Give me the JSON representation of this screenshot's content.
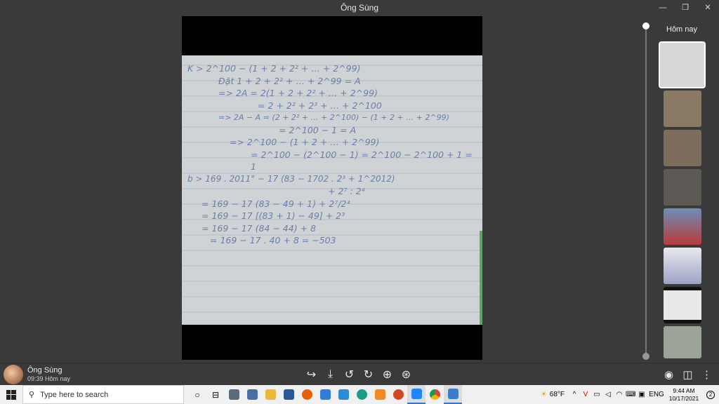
{
  "window": {
    "title": "Ông Sùng"
  },
  "sidebar": {
    "date_label": "Hôm nay"
  },
  "message": {
    "sender": "Ông Sùng",
    "time": "09:39 Hôm nay"
  },
  "notes": {
    "lines": [
      "K > 2^100 − (1 + 2 + 2² + … + 2^99)",
      "Đặt  1 + 2 + 2² + … + 2^99 = A",
      "=> 2A = 2(1 + 2 + 2² + … + 2^99)",
      "= 2 + 2² + 2³ + … + 2^100",
      "=> 2A − A = (2 + 2² + … + 2^100) − (1 + 2 + … + 2^99)",
      "= 2^100 − 1 = A",
      "=> 2^100 − (1 + 2 + … + 2^99)",
      "= 2^100 − (2^100 − 1) = 2^100 − 2^100 + 1 = 1",
      "b > 169 . 2011° − 17 (83 − 1702 . 2³ + 1^2012)",
      "+ 2⁷ : 2⁴",
      "= 169 − 17 (83 − 49 + 1) + 2⁷/2⁴",
      "= 169 − 17 [(83 + 1) − 49] + 2³",
      "= 169 − 17 (84 − 44) + 8",
      "= 169 − 17 . 40 + 8 = −503"
    ]
  },
  "toolbar": {
    "share_icon": "share-arrow-icon",
    "download_icon": "download-icon",
    "rotate_left_icon": "rotate-left-icon",
    "rotate_right_icon": "rotate-right-icon",
    "zoom_in_icon": "zoom-in-icon",
    "zoom_fit_icon": "zoom-fit-icon"
  },
  "taskbar": {
    "search_placeholder": "Type here to search",
    "weather": "68°F",
    "lang": "ENG",
    "time": "9:44 AM",
    "date": "10/17/2021",
    "notification_count": "2"
  }
}
